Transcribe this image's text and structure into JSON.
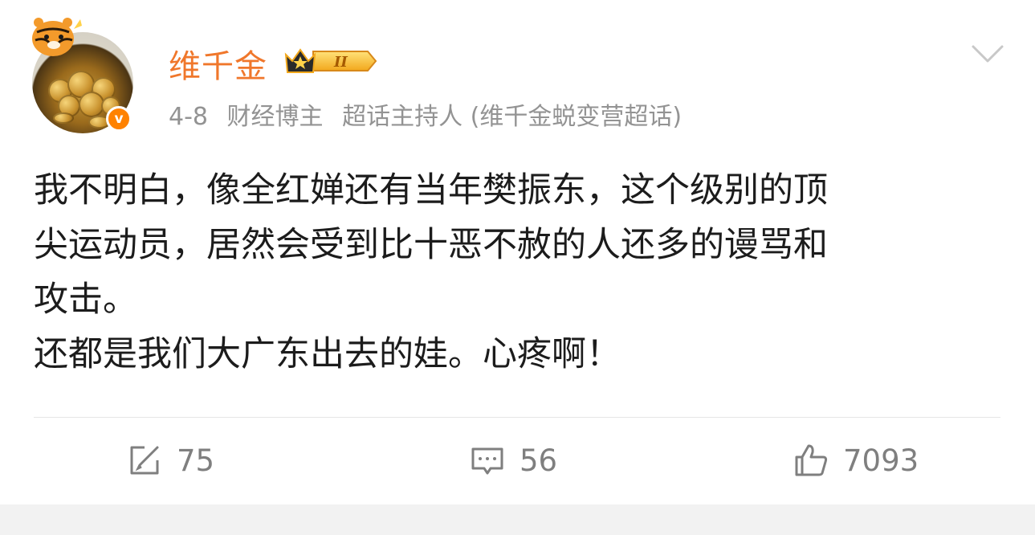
{
  "post": {
    "author": {
      "name": "维千金",
      "vip_level": "II",
      "verified_mark": "v",
      "avatar_icon": "tiger-gold-coins-avatar"
    },
    "meta": {
      "date": "4-8",
      "role": "财经博主",
      "topic": "超话主持人 (维千金蜕变营超话)"
    },
    "content_lines": [
      "我不明白，像全红婵还有当年樊振东，这个级别的顶",
      "尖运动员，居然会受到比十恶不赦的人还多的谩骂和",
      "攻击。",
      "还都是我们大广东出去的娃。心疼啊！"
    ],
    "actions": {
      "repost_count": "75",
      "comment_count": "56",
      "like_count": "7093"
    },
    "colors": {
      "accent": "#f0772b",
      "verified": "#ff8200",
      "meta_text": "#939393",
      "action_text": "#7f7f7f",
      "body_text": "#1c1c1c"
    }
  }
}
